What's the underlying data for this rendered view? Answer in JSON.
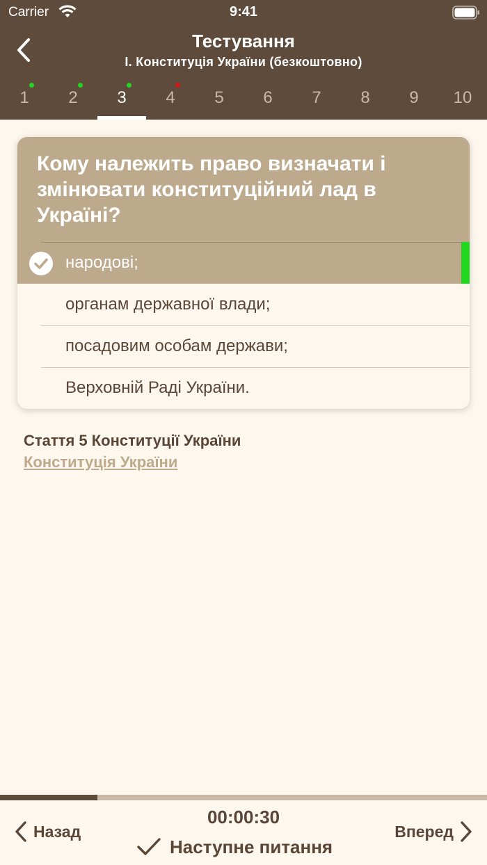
{
  "status_bar": {
    "carrier": "Carrier",
    "time": "9:41"
  },
  "header": {
    "title": "Тестування",
    "subtitle": "I.  Конституція України (безкоштовно)"
  },
  "tabs": [
    {
      "label": "1",
      "dot": "#22d322"
    },
    {
      "label": "2",
      "dot": "#22d322"
    },
    {
      "label": "3",
      "dot": "#22d322",
      "active": true
    },
    {
      "label": "4",
      "dot": "#d01616"
    },
    {
      "label": "5"
    },
    {
      "label": "6"
    },
    {
      "label": "7"
    },
    {
      "label": "8"
    },
    {
      "label": "9"
    },
    {
      "label": "10"
    }
  ],
  "question": {
    "text": "Кому належить право визначати і змінювати конституційний лад в Україні?",
    "answers": [
      {
        "label": "народові;",
        "selected": true,
        "correct": true
      },
      {
        "label": "органам державної влади;"
      },
      {
        "label": "посадовим особам держави;"
      },
      {
        "label": "Верховній Раді України."
      }
    ]
  },
  "source": {
    "title": "Стаття 5 Конституції України",
    "link": "Конституція України"
  },
  "bottom": {
    "progress": 0.2,
    "timer": "00:00:30",
    "back_label": "Назад",
    "forward_label": "Вперед",
    "next_label": "Наступне питання"
  },
  "colors": {
    "header": "#5f4b3b",
    "accent": "#bda98c",
    "background": "#fdf7ee",
    "correct": "#1fd81f",
    "text": "#5a4636"
  },
  "icons": [
    "back-chevron-icon",
    "wifi-icon",
    "battery-icon",
    "check-circle-icon",
    "checkmark-icon",
    "chevron-left-icon",
    "chevron-right-icon"
  ]
}
